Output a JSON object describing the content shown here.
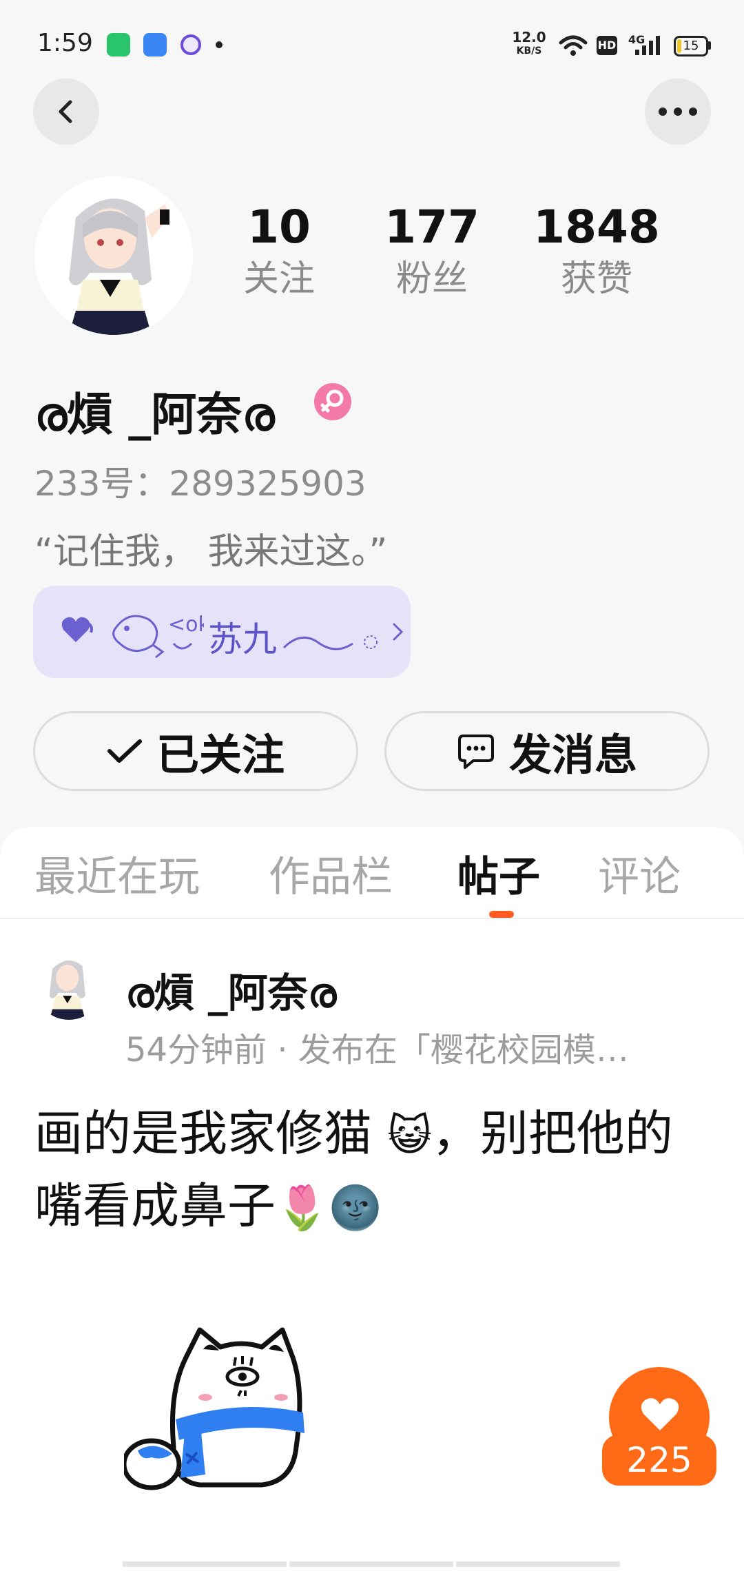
{
  "status_bar": {
    "time": "1:59",
    "speed_value": "12.0",
    "speed_unit": "KB/S",
    "hd": "HD",
    "network": "4G",
    "battery": "15",
    "battery_fraction": 0.15
  },
  "header": {
    "back_icon": "chevron-left-icon",
    "more_icon": "more-horizontal-icon"
  },
  "profile": {
    "stats": [
      {
        "value": "10",
        "label": "关注"
      },
      {
        "value": "177",
        "label": "粉丝"
      },
      {
        "value": "1848",
        "label": "获赞"
      }
    ],
    "username": "ര熕 _阿奈ര",
    "gender_icon": "female-icon",
    "id_text": "233号：289325903",
    "bio": "“记住我， 我来过这。”",
    "tag_label": "苏九",
    "actions": {
      "follow_label": "已关注",
      "message_label": "发消息"
    }
  },
  "tabs": [
    {
      "label": "最近在玩",
      "active": false
    },
    {
      "label": "作品栏",
      "active": false
    },
    {
      "label": "帖子",
      "active": true
    },
    {
      "label": "评论",
      "active": false
    }
  ],
  "post": {
    "author": "ര熕 _阿奈ര",
    "meta": "54分钟前 · 发布在「樱花校园模…",
    "text_a": "画的是我家修猫 ",
    "emoji_cat": "😺",
    "text_b": "，别把他的嘴看成鼻子",
    "emoji_tulip": "🌷",
    "emoji_moon": "🌚",
    "like_count": "225"
  },
  "colors": {
    "accent_orange": "#ff6a17",
    "tag_bg": "#e6e3f8",
    "tag_text": "#5e54c9",
    "gender_pink": "#f279a8"
  }
}
